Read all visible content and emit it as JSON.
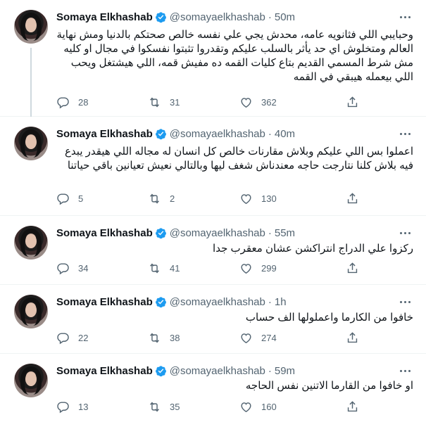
{
  "tweets": [
    {
      "name": "Somaya Elkhashab",
      "handle": "@somayaelkhashab",
      "time": "50m",
      "separator": "·",
      "text": "وحبايبي اللي فثانويه عامه، محدش يجي علي نفسه خالص صحتكم بالدنيا ومش نهاية العالم ومتخلوش اي حد يأثر بالسلب عليكم وتقدروا تثبتوا نفسكوا في مجال او كليه مش شرط المسمي القديم بتاع كليات القمه ده مفيش قمه، اللي هيشتغل ويحب اللي بيعمله هيبقي في القمه",
      "replies": "28",
      "retweets": "31",
      "likes": "362"
    },
    {
      "name": "Somaya Elkhashab",
      "handle": "@somayaelkhashab",
      "time": "40m",
      "separator": "·",
      "text": "اعملوا بس اللي عليكم وبلاش مقارنات خالص كل انسان له مجاله اللي هيقدر يبدع فيه بلاش كلنا نتارجت حاجه معندناش شغف ليها وبالتالي نعيش تعيانين باقي حياتنا",
      "replies": "5",
      "retweets": "2",
      "likes": "130"
    },
    {
      "name": "Somaya Elkhashab",
      "handle": "@somayaelkhashab",
      "time": "55m",
      "separator": "·",
      "text": "ركزوا علي الدراج انتراكشن عشان معقرب جدا",
      "replies": "34",
      "retweets": "41",
      "likes": "299"
    },
    {
      "name": "Somaya Elkhashab",
      "handle": "@somayaelkhashab",
      "time": "1h",
      "separator": "·",
      "text": "خافوا من الكارما واعملولها الف حساب",
      "replies": "22",
      "retweets": "38",
      "likes": "274"
    },
    {
      "name": "Somaya Elkhashab",
      "handle": "@somayaelkhashab",
      "time": "59m",
      "separator": "·",
      "text": "او خافوا من القارما الاتنين نفس الحاجه",
      "replies": "13",
      "retweets": "35",
      "likes": "160"
    }
  ],
  "icons": {
    "verified": "verified-badge-icon",
    "more": "more-icon",
    "reply": "reply-icon",
    "retweet": "retweet-icon",
    "like": "like-icon",
    "share": "share-icon"
  },
  "colors": {
    "verified": "#1d9bf0",
    "text": "#0f1419",
    "muted": "#536471",
    "divider": "#eff3f4",
    "thread_line": "#cfd9de"
  }
}
